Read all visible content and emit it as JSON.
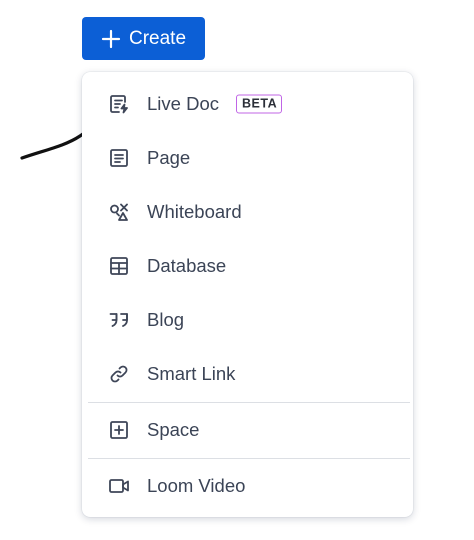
{
  "create_button": {
    "label": "Create",
    "icon": "plus-icon",
    "color": "#0c5fd6"
  },
  "menu": {
    "items": [
      {
        "label": "Live Doc",
        "icon": "live-doc-icon",
        "badge": "BETA"
      },
      {
        "label": "Page",
        "icon": "page-icon"
      },
      {
        "label": "Whiteboard",
        "icon": "whiteboard-icon"
      },
      {
        "label": "Database",
        "icon": "database-icon"
      },
      {
        "label": "Blog",
        "icon": "blog-quote-icon"
      },
      {
        "label": "Smart Link",
        "icon": "link-icon"
      },
      {
        "label": "Space",
        "icon": "space-icon"
      },
      {
        "label": "Loom Video",
        "icon": "video-camera-icon"
      }
    ]
  },
  "colors": {
    "badge_border": "#c065e6",
    "text": "#3b4456"
  }
}
